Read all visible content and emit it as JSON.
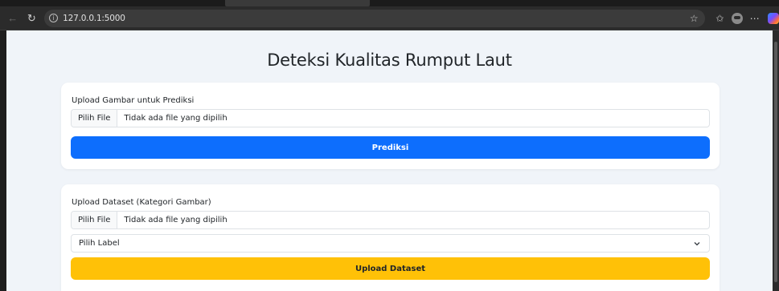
{
  "browser": {
    "url": "127.0.0.1:5000"
  },
  "page": {
    "title": "Deteksi Kualitas Rumput Laut"
  },
  "predict_card": {
    "label": "Upload Gambar untuk Prediksi",
    "file_button": "Pilih File",
    "file_status": "Tidak ada file yang dipilih",
    "submit_label": "Prediksi"
  },
  "dataset_card": {
    "label": "Upload Dataset (Kategori Gambar)",
    "file_button": "Pilih File",
    "file_status": "Tidak ada file yang dipilih",
    "select_value": "Pilih Label",
    "submit_label": "Upload Dataset"
  },
  "colors": {
    "primary": "#0d6efd",
    "warning": "#ffc107",
    "page_bg": "#f0f4f9"
  }
}
